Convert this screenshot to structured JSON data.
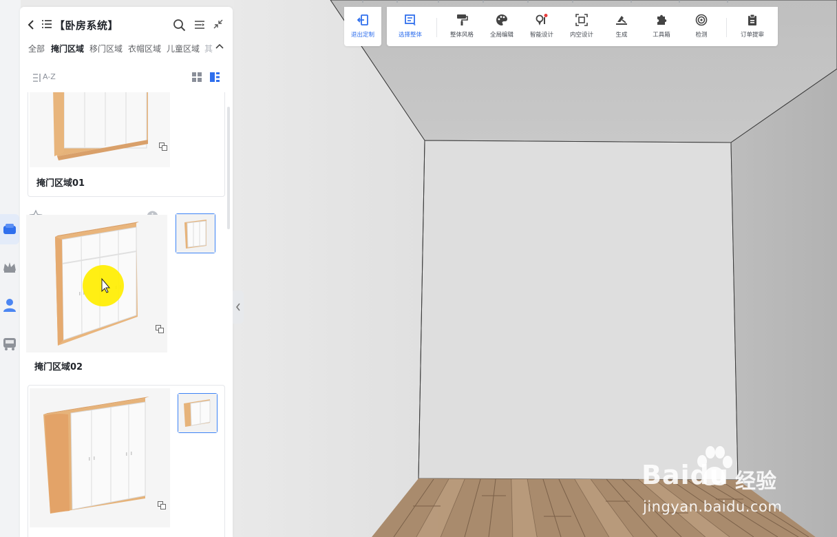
{
  "colors": {
    "accent": "#2f6fed",
    "panel_bg": "#ffffff",
    "rail_bg": "#f2f3f5",
    "wall": "#dcdcdc",
    "floor_wood": "#a8896b",
    "cabinet_wood": "#e8b57c",
    "cursor_highlight": "#ffee00"
  },
  "rail": {
    "items": [
      {
        "icon": "cabinet-icon",
        "active": true
      },
      {
        "icon": "crown-icon",
        "active": false
      },
      {
        "icon": "user-icon",
        "active": false
      },
      {
        "icon": "vehicle-icon",
        "active": false
      }
    ]
  },
  "panel": {
    "title": "【卧房系统】",
    "tabs": [
      "全部",
      "掩门区域",
      "移门区域",
      "衣帽区域",
      "儿童区域",
      "其"
    ],
    "active_tab": "掩门区域",
    "sort_label": "A-Z",
    "items": [
      {
        "name": "掩门区域01"
      },
      {
        "name": "掩门区域02"
      },
      {
        "name": ""
      }
    ]
  },
  "toolbar": {
    "exit": {
      "label": "退出定制",
      "icon": "exit-icon"
    },
    "items": [
      {
        "label": "选择整体",
        "icon": "select-icon"
      },
      {
        "label": "整体风格",
        "icon": "paint-roller-icon"
      },
      {
        "label": "全局编辑",
        "icon": "palette-icon"
      },
      {
        "label": "智能设计",
        "icon": "smart-design-icon"
      },
      {
        "label": "内空设计",
        "icon": "inner-space-icon"
      },
      {
        "label": "生成",
        "icon": "generate-icon"
      },
      {
        "label": "工具箱",
        "icon": "puzzle-icon"
      },
      {
        "label": "检测",
        "icon": "detect-icon"
      },
      {
        "label": "订单提审",
        "icon": "order-icon"
      }
    ]
  },
  "watermark": {
    "brand": "Baidu",
    "brand_cn": "经验",
    "url": "jingyan.baidu.com"
  }
}
